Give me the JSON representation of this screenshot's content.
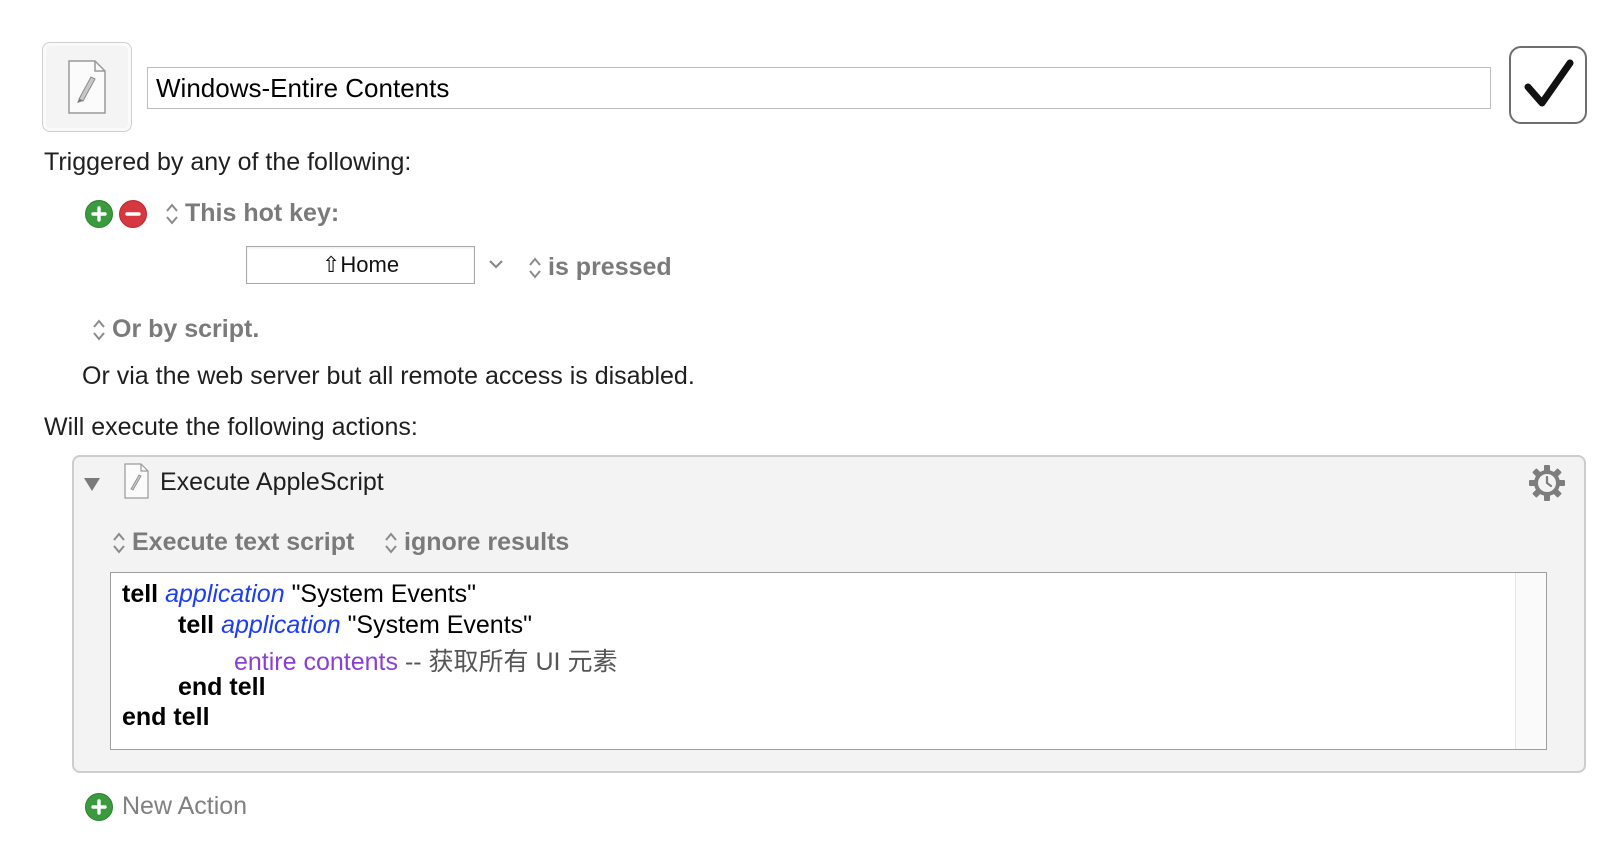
{
  "macro": {
    "name": "Windows-Entire Contents",
    "enabled": true,
    "icon": "applescript-document-icon"
  },
  "triggers": {
    "heading": "Triggered by any of the following:",
    "hotkey_label": "This hot key:",
    "hotkey_value": "⇧Home",
    "hotkey_state": "is pressed",
    "script_trigger": "Or by script.",
    "web_server_note": "Or via the web server but all remote access is disabled."
  },
  "actions": {
    "heading": "Will execute the following actions:",
    "items": [
      {
        "title": "Execute AppleScript",
        "source_option": "Execute text script",
        "results_option": "ignore results",
        "script": {
          "line1": {
            "kw": "tell",
            "app": "application",
            "str": "\"System Events\""
          },
          "line2": {
            "kw": "tell",
            "app": "application",
            "str": "\"System Events\""
          },
          "line3": {
            "prop": "entire contents",
            "cmt": "-- 获取所有 UI 元素"
          },
          "line4": {
            "kw": "end tell"
          },
          "line5": {
            "kw": "end tell"
          }
        }
      }
    ]
  },
  "new_action_label": "New Action",
  "colors": {
    "add_green": "#3a9b3e",
    "remove_red": "#d7373e",
    "application_blue": "#1b3df5",
    "property_purple": "#8a3fd6"
  }
}
